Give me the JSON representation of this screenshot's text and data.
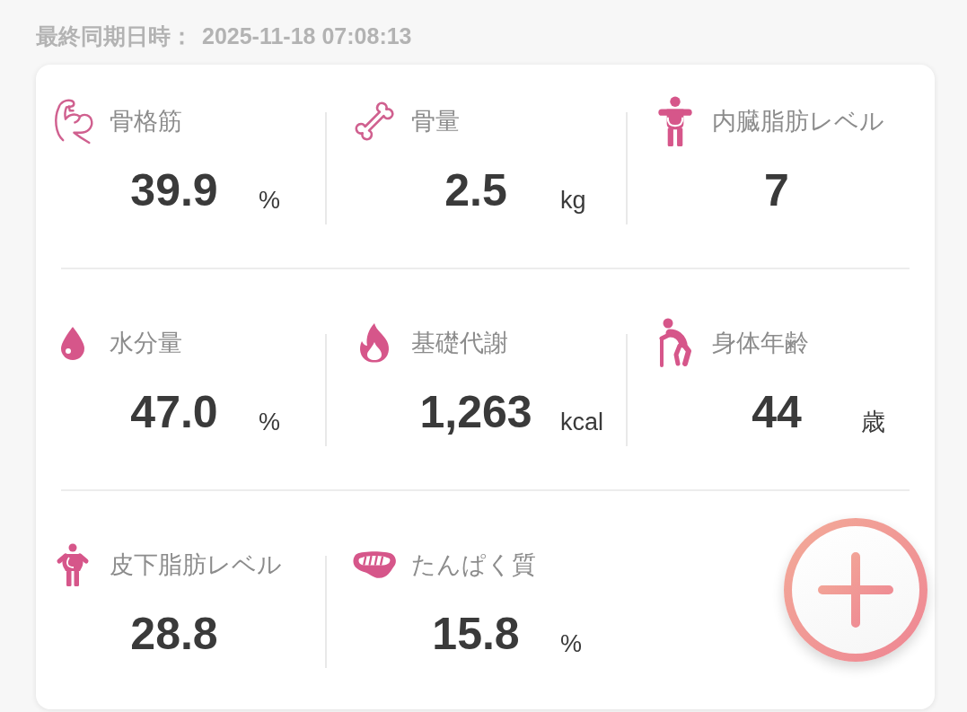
{
  "last_sync": {
    "label": "最終同期日時：",
    "value": "2025-11-18 07:08:13"
  },
  "metrics": [
    {
      "label": "骨格筋",
      "value": "39.9",
      "unit": "%"
    },
    {
      "label": "骨量",
      "value": "2.5",
      "unit": "kg"
    },
    {
      "label": "内臓脂肪レベル",
      "value": "7"
    },
    {
      "label": "水分量",
      "value": "47.0",
      "unit": "%"
    },
    {
      "label": "基礎代謝",
      "value": "1,263",
      "unit": "kcal"
    },
    {
      "label": "身体年齢",
      "value": "44",
      "unit": "歳"
    },
    {
      "label": "皮下脂肪レベル",
      "value": "28.8"
    },
    {
      "label": "たんぱく質",
      "value": "15.8",
      "unit": "%"
    }
  ]
}
